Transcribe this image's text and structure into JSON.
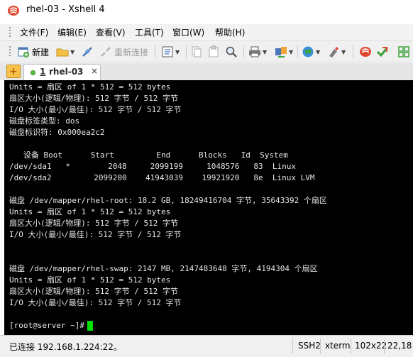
{
  "window": {
    "title": "rhel-03 - Xshell 4"
  },
  "menu": {
    "items": [
      {
        "label": "文件(F)"
      },
      {
        "label": "编辑(E)"
      },
      {
        "label": "查看(V)"
      },
      {
        "label": "工具(T)"
      },
      {
        "label": "窗口(W)"
      },
      {
        "label": "帮助(H)"
      }
    ]
  },
  "toolbar": {
    "new_label": "新建",
    "reconnect_label": "重新连接"
  },
  "tab": {
    "number": "1",
    "label": "rhel-03",
    "close": "×"
  },
  "terminal": {
    "lines": [
      "Units = 扇区 of 1 * 512 = 512 bytes",
      "扇区大小(逻辑/物理): 512 字节 / 512 字节",
      "I/O 大小(最小/最佳): 512 字节 / 512 字节",
      "磁盘标签类型: dos",
      "磁盘标识符: 0x000ea2c2",
      "",
      "   设备 Boot      Start         End      Blocks   Id  System",
      "/dev/sda1   *        2048     2099199     1048576   83  Linux",
      "/dev/sda2         2099200    41943039    19921920   8e  Linux LVM",
      "",
      "磁盘 /dev/mapper/rhel-root: 18.2 GB, 18249416704 字节, 35643392 个扇区",
      "Units = 扇区 of 1 * 512 = 512 bytes",
      "扇区大小(逻辑/物理): 512 字节 / 512 字节",
      "I/O 大小(最小/最佳): 512 字节 / 512 字节",
      "",
      "",
      "磁盘 /dev/mapper/rhel-swap: 2147 MB, 2147483648 字节, 4194304 个扇区",
      "Units = 扇区 of 1 * 512 = 512 bytes",
      "扇区大小(逻辑/物理): 512 字节 / 512 字节",
      "I/O 大小(最小/最佳): 512 字节 / 512 字节",
      "",
      ""
    ],
    "prompt": "[root@server ~]#"
  },
  "status": {
    "connection": "已连接 192.168.1.224:22。",
    "protocol": "SSH2",
    "terminal_type": "xterm",
    "size": "102x22",
    "position": "22,18"
  },
  "colors": {
    "terminal_bg": "#000000",
    "terminal_fg": "#e6e6e6",
    "cursor": "#00e000"
  }
}
